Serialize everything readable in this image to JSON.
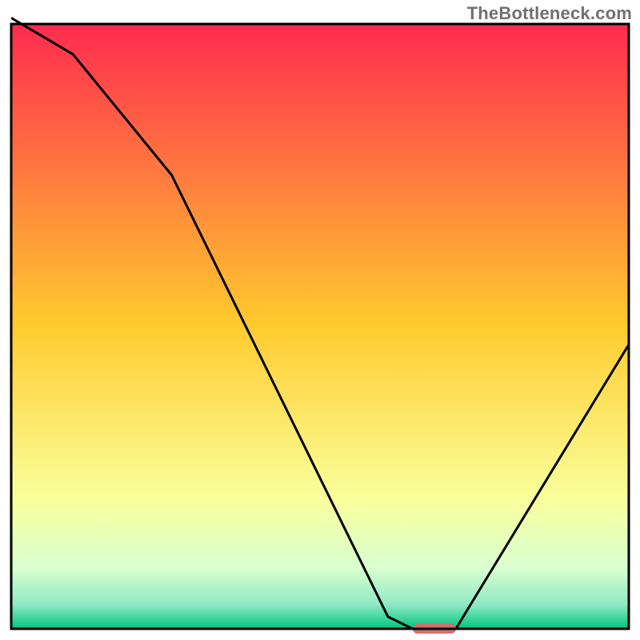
{
  "watermark": "TheBottleneck.com",
  "chart_data": {
    "type": "line",
    "title": "",
    "xlabel": "",
    "ylabel": "",
    "xlim": [
      0,
      100
    ],
    "ylim": [
      0,
      100
    ],
    "series": [
      {
        "name": "bottleneck-curve",
        "x": [
          0,
          5,
          10,
          26,
          61,
          65,
          72,
          100
        ],
        "values": [
          101,
          98,
          95,
          75,
          2,
          0,
          0,
          47
        ]
      }
    ],
    "marker": {
      "name": "optimal-range",
      "x_start": 65,
      "x_end": 72,
      "color": "#d26e72"
    },
    "background_gradient": {
      "top": "#ff2b4f",
      "mid1": "#ffcb2e",
      "mid2": "#faff9a",
      "mid3": "#d9ffd0",
      "mid4": "#8fe9c4",
      "bottom": "#00c47e"
    },
    "frame_color": "#000000",
    "line_color": "#000000"
  }
}
